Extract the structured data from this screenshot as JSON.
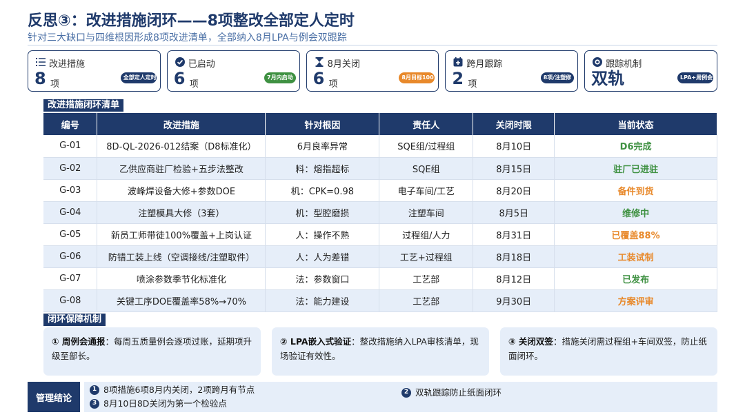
{
  "header": {
    "title": "反思③：改进措施闭环——8项整改全部定人定时",
    "subtitle": "针对三大缺口与四维根因形成8项改进清单，全部纳入8月LPA与例会双跟踪"
  },
  "kpis": [
    {
      "label": "改进措施",
      "value": "8",
      "unit": "项",
      "badge": "全部定人定时",
      "icon": "list-icon",
      "badge_color": "#1f3a6b"
    },
    {
      "label": "已启动",
      "value": "6",
      "unit": "项",
      "badge": "7月内启动",
      "icon": "check-circle-icon",
      "badge_color": "#3f9142"
    },
    {
      "label": "8月关闭",
      "value": "6",
      "unit": "项",
      "badge": "8月目标100",
      "icon": "hourglass-icon",
      "badge_color": "#e8892b"
    },
    {
      "label": "跨月跟踪",
      "value": "2",
      "unit": "项",
      "badge": "8项/注塑修",
      "icon": "calendar-plus-icon",
      "badge_color": "#1f3a6b"
    },
    {
      "label": "跟踪机制",
      "value": "双轨",
      "unit": "",
      "badge": "LPA+周例会",
      "icon": "eye-icon",
      "badge_color": "#1f3a6b"
    }
  ],
  "table_section": {
    "title": "改进措施闭环清单"
  },
  "table": {
    "headers": [
      "编号",
      "改进措施",
      "针对根因",
      "责任人",
      "关闭时限",
      "当前状态"
    ],
    "rows": [
      {
        "id": "G-01",
        "measure": "8D-QL-2026-012结案（D8标准化）",
        "cause": "6月良率异常",
        "owner": "SQE组/过程组",
        "deadline": "8月10日",
        "status": "D6完成",
        "status_color": "#3f9142"
      },
      {
        "id": "G-02",
        "measure": "乙供应商驻厂检验+五步法整改",
        "cause": "料：熔指超标",
        "owner": "SQE组",
        "deadline": "8月15日",
        "status": "驻厂已进驻",
        "status_color": "#3f9142"
      },
      {
        "id": "G-03",
        "measure": "波峰焊设备大修+参数DOE",
        "cause": "机：CPK=0.98",
        "owner": "电子车间/工艺",
        "deadline": "8月20日",
        "status": "备件到货",
        "status_color": "#e8892b"
      },
      {
        "id": "G-04",
        "measure": "注塑模具大修（3套）",
        "cause": "机：型腔磨损",
        "owner": "注塑车间",
        "deadline": "8月5日",
        "status": "维修中",
        "status_color": "#3f9142"
      },
      {
        "id": "G-05",
        "measure": "新员工师带徒100%覆盖+上岗认证",
        "cause": "人：操作不熟",
        "owner": "过程组/人力",
        "deadline": "8月31日",
        "status": "已覆盖88%",
        "status_color": "#e8892b"
      },
      {
        "id": "G-06",
        "measure": "防错工装上线（空调接线/注塑取件）",
        "cause": "人：人为差错",
        "owner": "工艺+过程组",
        "deadline": "8月18日",
        "status": "工装试制",
        "status_color": "#e8892b"
      },
      {
        "id": "G-07",
        "measure": "喷涂参数季节化标准化",
        "cause": "法：参数窗口",
        "owner": "工艺部",
        "deadline": "8月12日",
        "status": "已发布",
        "status_color": "#3f9142"
      },
      {
        "id": "G-08",
        "measure": "关键工序DOE覆盖率58%→70%",
        "cause": "法：能力建设",
        "owner": "工艺部",
        "deadline": "9月30日",
        "status": "方案评审",
        "status_color": "#e8892b"
      }
    ]
  },
  "guarantee_section": {
    "title": "闭环保障机制"
  },
  "guarantees": [
    {
      "head": "① 周例会通报",
      "body": "：每周五质量例会逐项过账，延期项升级至部长。"
    },
    {
      "head": "② LPA嵌入式验证",
      "body": "：整改措施纳入LPA审核清单，现场验证有效性。"
    },
    {
      "head": "③ 关闭双签",
      "body": "：措施关闭需过程组+车间双签，防止纸面闭环。"
    }
  ],
  "conclusion": {
    "label": "管理结论",
    "items": [
      {
        "num": "1",
        "text": "8项措施6项8月内关闭，2项跨月有节点"
      },
      {
        "num": "2",
        "text": "双轨跟踪防止纸面闭环"
      },
      {
        "num": "3",
        "text": "8月10日8D关闭为第一个检验点"
      }
    ]
  },
  "colors": {
    "primary": "#1f3a6b",
    "green": "#3f9142",
    "orange": "#e8892b",
    "light_bg": "#e6eef9"
  }
}
